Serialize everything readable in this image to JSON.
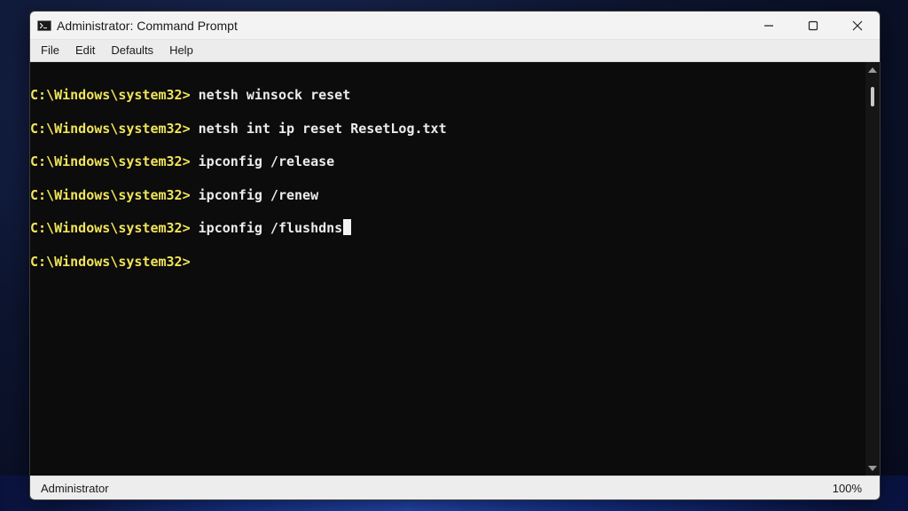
{
  "window": {
    "title": "Administrator: Command Prompt"
  },
  "menu": [
    "File",
    "Edit",
    "Defaults",
    "Help"
  ],
  "console": {
    "lines": [
      {
        "prompt": "C:\\Windows\\system32>",
        "command": " netsh winsock reset"
      },
      {
        "prompt": "C:\\Windows\\system32>",
        "command": " netsh int ip reset ResetLog.txt"
      },
      {
        "prompt": "C:\\Windows\\system32>",
        "command": " ipconfig /release"
      },
      {
        "prompt": "C:\\Windows\\system32>",
        "command": " ipconfig /renew"
      },
      {
        "prompt": "C:\\Windows\\system32>",
        "command": " ipconfig /flushdns"
      },
      {
        "prompt": "C:\\Windows\\system32>",
        "command": ""
      }
    ],
    "prompt_color": "#f0e35a",
    "text_color": "#ececec"
  },
  "status": {
    "user": "Administrator",
    "zoom": "100%"
  },
  "icons": {
    "app": "console-icon",
    "minimize": "minimize-icon",
    "maximize": "maximize-icon",
    "close": "close-icon"
  }
}
